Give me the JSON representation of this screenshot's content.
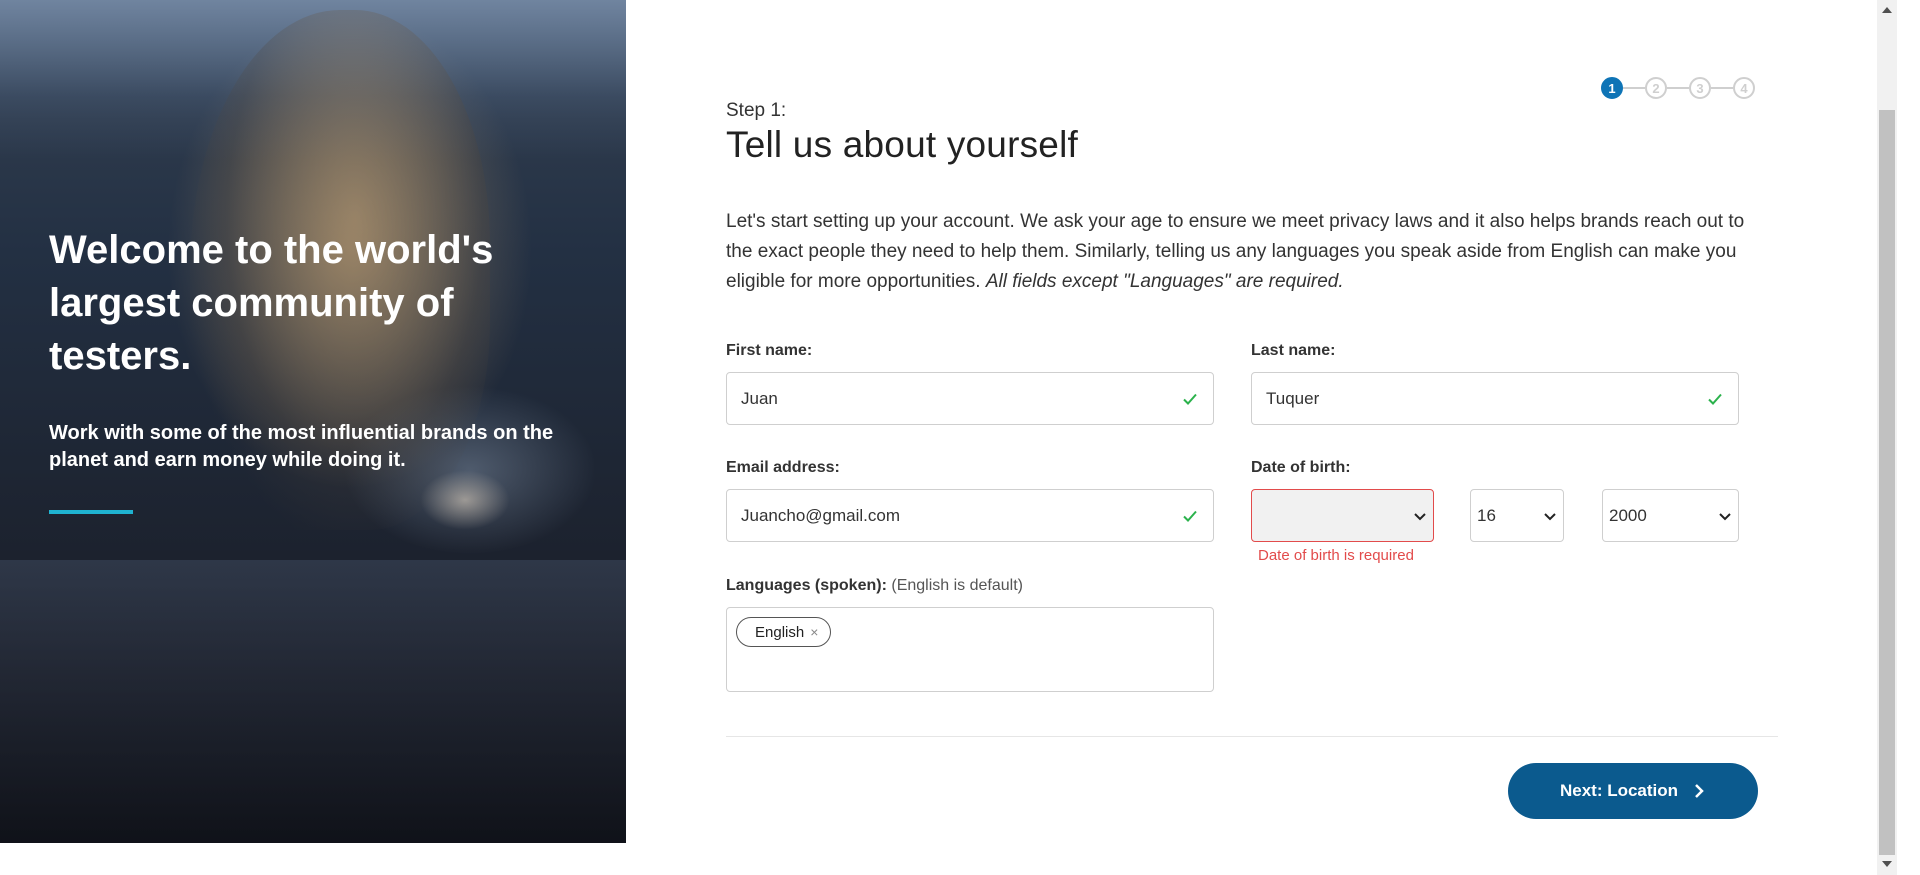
{
  "hero": {
    "title": "Welcome to the world's largest community of testers.",
    "subtitle": "Work with some of the most influential brands on the planet and earn money while doing it.",
    "accent_color": "#1fb3d1"
  },
  "stepper": {
    "steps": [
      "1",
      "2",
      "3",
      "4"
    ],
    "current_step": 1,
    "active_color": "#0e74b6"
  },
  "header": {
    "step_label": "Step 1:",
    "title": "Tell us about yourself"
  },
  "intro": {
    "text": "Let's start setting up your account. We ask your age to ensure we meet privacy laws and it also helps brands reach out to the exact people they need to help them. Similarly, telling us any languages you speak aside from English can make you eligible for more opportunities. ",
    "note": "All fields except \"Languages\" are required."
  },
  "form": {
    "first_name": {
      "label": "First name:",
      "value": "Juan",
      "status_icon": "check-icon"
    },
    "last_name": {
      "label": "Last name:",
      "value": "Tuquer",
      "status_icon": "check-icon"
    },
    "email": {
      "label": "Email address:",
      "value": "Juancho@gmail.com",
      "status_icon": "check-icon"
    },
    "dob": {
      "label": "Date of birth:",
      "month": "",
      "day": "16",
      "year": "2000",
      "error": "Date of birth is required",
      "error_color": "#e24b4b"
    },
    "languages": {
      "label": "Languages (spoken):",
      "hint": "(English is default)",
      "selected": [
        "English"
      ],
      "remove_symbol": "×"
    }
  },
  "actions": {
    "next_label": "Next: Location",
    "next_color": "#0b5a8e"
  },
  "colors": {
    "valid_check": "#2bb24c"
  }
}
